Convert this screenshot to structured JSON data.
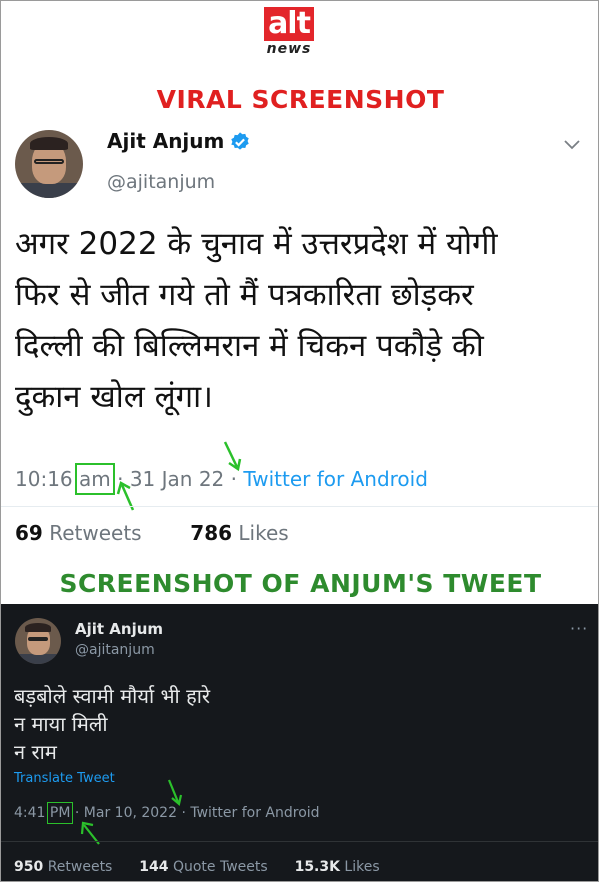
{
  "logo": {
    "mark": "alt",
    "sub": "news"
  },
  "headings": {
    "viral": "VIRAL SCREENSHOT",
    "anjum": "SCREENSHOT OF ANJUM'S TWEET"
  },
  "viral_tweet": {
    "name": "Ajit Anjum",
    "handle": "@ajitanjum",
    "text_lines": [
      "अगर 2022 के चुनाव में उत्तरप्रदेश में योगी",
      "फिर से जीत गये तो मैं पत्रकारिता छोड़कर",
      "दिल्ली की बिल्लिमरान में चिकन पकौड़े की",
      "दुकान खोल लूंगा।"
    ],
    "time": "10:16",
    "ampm": "am",
    "date": "· 31 Jan 22 ·",
    "source": "Twitter for Android",
    "retweets_count": "69",
    "retweets_label": "Retweets",
    "likes_count": "786",
    "likes_label": "Likes"
  },
  "real_tweet": {
    "name": "Ajit Anjum",
    "handle": "@ajitanjum",
    "more": "···",
    "text_lines": [
      "बड़बोले स्वामी मौर्या भी हारे",
      "न माया मिली",
      "न राम"
    ],
    "translate": "Translate Tweet",
    "time": "4:41",
    "ampm": "PM",
    "date": "· Mar 10, 2022 ·",
    "source": "Twitter for Android",
    "retweets_count": "950",
    "retweets_label": "Retweets",
    "quotes_count": "144",
    "quotes_label": "Quote Tweets",
    "likes_count": "15.3K",
    "likes_label": "Likes"
  },
  "colors": {
    "brand_red": "#e3262b",
    "viral_heading": "#e02020",
    "anjum_heading": "#2e8b2e",
    "highlight": "#2bc02b",
    "twitter_blue": "#1d9bf0"
  },
  "icons": [
    "verified-badge-icon",
    "chevron-down-icon",
    "more-options-icon",
    "green-arrow-icon"
  ]
}
